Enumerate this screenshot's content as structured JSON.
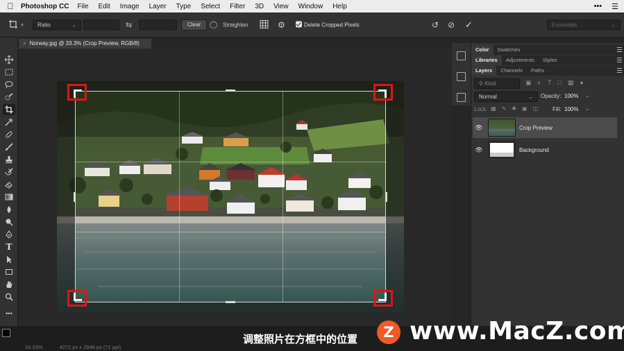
{
  "menubar": {
    "apple_icon": "apple-icon",
    "app_name": "Photoshop CC",
    "items": [
      "File",
      "Edit",
      "Image",
      "Layer",
      "Type",
      "Select",
      "Filter",
      "3D",
      "View",
      "Window",
      "Help"
    ]
  },
  "options_bar": {
    "ratio_value": "Ratio",
    "clear_label": "Clear",
    "straighten_label": "Straighten",
    "delete_cropped_label": "Delete Cropped Pixels",
    "delete_cropped_checked": true,
    "workspace_value": "Essentials"
  },
  "document": {
    "tab_title": "Norway.jpg @ 33.3% (Crop Preview, RGB/8)",
    "zoom": "33.33%",
    "doc_info": "4272 px x 2848 px (72 ppi)"
  },
  "panels": {
    "top_tabs": [
      "Color",
      "Swatches"
    ],
    "mid_tabs": [
      "Libraries",
      "Adjustments",
      "Styles"
    ],
    "layer_tabs": [
      "Layers",
      "Channels",
      "Paths"
    ],
    "kind_placeholder": "Kind",
    "blend_mode": "Normal",
    "opacity_label": "Opacity:",
    "opacity_value": "100%",
    "lock_label": "Lock:",
    "fill_label": "Fill:",
    "fill_value": "100%",
    "layers": [
      {
        "name": "Crop Preview",
        "selected": true
      },
      {
        "name": "Background",
        "selected": false
      }
    ]
  },
  "watermark": {
    "caption": "调整照片在方框中的位置",
    "logo_letter": "Z",
    "brand": "www.MacZ.com"
  },
  "colors": {
    "crop_highlight": "#e01414",
    "brand_orange": "#f05a28"
  }
}
